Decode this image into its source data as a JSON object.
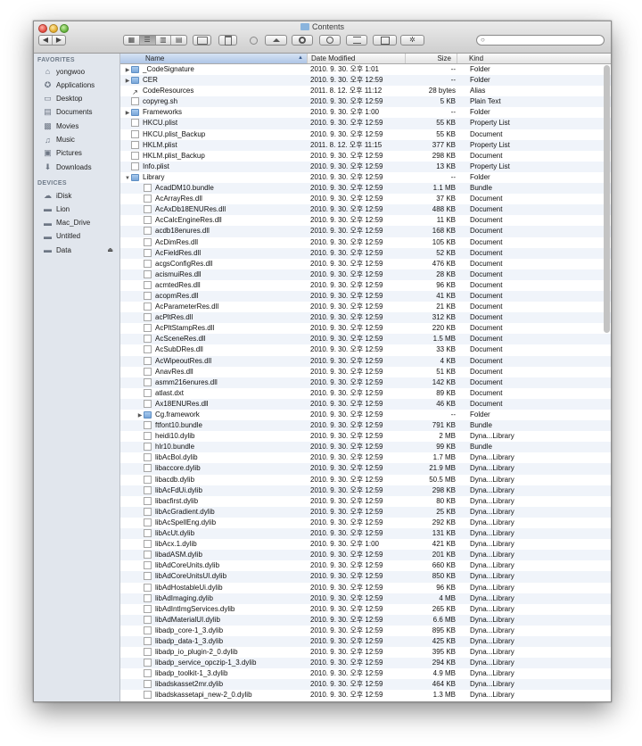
{
  "window": {
    "title": "Contents"
  },
  "toolbar": {
    "nav": [
      "◀",
      "▶"
    ],
    "view_modes": [
      "▦",
      "☰",
      "▥",
      "▤"
    ],
    "search_placeholder": ""
  },
  "sidebar": {
    "favorites_header": "FAVORITES",
    "favorites": [
      {
        "label": "yongwoo",
        "icon": "home-icon"
      },
      {
        "label": "Applications",
        "icon": "applications-icon"
      },
      {
        "label": "Desktop",
        "icon": "desktop-icon"
      },
      {
        "label": "Documents",
        "icon": "documents-icon"
      },
      {
        "label": "Movies",
        "icon": "movies-icon"
      },
      {
        "label": "Music",
        "icon": "music-icon"
      },
      {
        "label": "Pictures",
        "icon": "pictures-icon"
      },
      {
        "label": "Downloads",
        "icon": "downloads-icon"
      }
    ],
    "devices_header": "DEVICES",
    "devices": [
      {
        "label": "iDisk",
        "icon": "idisk-icon"
      },
      {
        "label": "Lion",
        "icon": "disk-icon"
      },
      {
        "label": "Mac_Drive",
        "icon": "disk-icon"
      },
      {
        "label": "Untitled",
        "icon": "disk-icon"
      },
      {
        "label": "Data",
        "icon": "disk-icon",
        "eject": "⏏"
      }
    ]
  },
  "columns": {
    "name": "Name",
    "date": "Date Modified",
    "size": "Size",
    "kind": "Kind"
  },
  "files": [
    {
      "name": "_CodeSignature",
      "date": "2010. 9. 30. 오후 1:01",
      "size": "--",
      "kind": "Folder",
      "depth": 0,
      "icon": "folder",
      "disc": "▶"
    },
    {
      "name": "CER",
      "date": "2010. 9. 30. 오후 12:59",
      "size": "--",
      "kind": "Folder",
      "depth": 0,
      "icon": "folder",
      "disc": "▶"
    },
    {
      "name": "CodeResources",
      "date": "2011. 8. 12. 오후 11:12",
      "size": "28 bytes",
      "kind": "Alias",
      "depth": 0,
      "icon": "alias"
    },
    {
      "name": "copyreg.sh",
      "date": "2010. 9. 30. 오후 12:59",
      "size": "5 KB",
      "kind": "Plain Text",
      "depth": 0,
      "icon": "doc"
    },
    {
      "name": "Frameworks",
      "date": "2010. 9. 30. 오후 1:00",
      "size": "--",
      "kind": "Folder",
      "depth": 0,
      "icon": "folder",
      "disc": "▶"
    },
    {
      "name": "HKCU.plist",
      "date": "2010. 9. 30. 오후 12:59",
      "size": "55 KB",
      "kind": "Property List",
      "depth": 0,
      "icon": "doc"
    },
    {
      "name": "HKCU.plist_Backup",
      "date": "2010. 9. 30. 오후 12:59",
      "size": "55 KB",
      "kind": "Document",
      "depth": 0,
      "icon": "doc"
    },
    {
      "name": "HKLM.plist",
      "date": "2011. 8. 12. 오후 11:15",
      "size": "377 KB",
      "kind": "Property List",
      "depth": 0,
      "icon": "doc"
    },
    {
      "name": "HKLM.plist_Backup",
      "date": "2010. 9. 30. 오후 12:59",
      "size": "298 KB",
      "kind": "Document",
      "depth": 0,
      "icon": "doc"
    },
    {
      "name": "Info.plist",
      "date": "2010. 9. 30. 오후 12:59",
      "size": "13 KB",
      "kind": "Property List",
      "depth": 0,
      "icon": "doc"
    },
    {
      "name": "Library",
      "date": "2010. 9. 30. 오후 12:59",
      "size": "--",
      "kind": "Folder",
      "depth": 0,
      "icon": "folder",
      "disc": "▼"
    },
    {
      "name": "AcadDM10.bundle",
      "date": "2010. 9. 30. 오후 12:59",
      "size": "1.1 MB",
      "kind": "Bundle",
      "depth": 1,
      "icon": "doc"
    },
    {
      "name": "AcArrayRes.dll",
      "date": "2010. 9. 30. 오후 12:59",
      "size": "37 KB",
      "kind": "Document",
      "depth": 1,
      "icon": "doc"
    },
    {
      "name": "AcAxDb18ENURes.dll",
      "date": "2010. 9. 30. 오후 12:59",
      "size": "488 KB",
      "kind": "Document",
      "depth": 1,
      "icon": "doc"
    },
    {
      "name": "AcCalcEngineRes.dll",
      "date": "2010. 9. 30. 오후 12:59",
      "size": "11 KB",
      "kind": "Document",
      "depth": 1,
      "icon": "doc"
    },
    {
      "name": "acdb18enures.dll",
      "date": "2010. 9. 30. 오후 12:59",
      "size": "168 KB",
      "kind": "Document",
      "depth": 1,
      "icon": "doc"
    },
    {
      "name": "AcDimRes.dll",
      "date": "2010. 9. 30. 오후 12:59",
      "size": "105 KB",
      "kind": "Document",
      "depth": 1,
      "icon": "doc"
    },
    {
      "name": "AcFieldRes.dll",
      "date": "2010. 9. 30. 오후 12:59",
      "size": "52 KB",
      "kind": "Document",
      "depth": 1,
      "icon": "doc"
    },
    {
      "name": "acgsConfigRes.dll",
      "date": "2010. 9. 30. 오후 12:59",
      "size": "476 KB",
      "kind": "Document",
      "depth": 1,
      "icon": "doc"
    },
    {
      "name": "acismuiRes.dll",
      "date": "2010. 9. 30. 오후 12:59",
      "size": "28 KB",
      "kind": "Document",
      "depth": 1,
      "icon": "doc"
    },
    {
      "name": "acmtedRes.dll",
      "date": "2010. 9. 30. 오후 12:59",
      "size": "96 KB",
      "kind": "Document",
      "depth": 1,
      "icon": "doc"
    },
    {
      "name": "acopmRes.dll",
      "date": "2010. 9. 30. 오후 12:59",
      "size": "41 KB",
      "kind": "Document",
      "depth": 1,
      "icon": "doc"
    },
    {
      "name": "AcParameterRes.dll",
      "date": "2010. 9. 30. 오후 12:59",
      "size": "21 KB",
      "kind": "Document",
      "depth": 1,
      "icon": "doc"
    },
    {
      "name": "acPltRes.dll",
      "date": "2010. 9. 30. 오후 12:59",
      "size": "312 KB",
      "kind": "Document",
      "depth": 1,
      "icon": "doc"
    },
    {
      "name": "AcPltStampRes.dll",
      "date": "2010. 9. 30. 오후 12:59",
      "size": "220 KB",
      "kind": "Document",
      "depth": 1,
      "icon": "doc"
    },
    {
      "name": "AcSceneRes.dll",
      "date": "2010. 9. 30. 오후 12:59",
      "size": "1.5 MB",
      "kind": "Document",
      "depth": 1,
      "icon": "doc"
    },
    {
      "name": "AcSubDRes.dll",
      "date": "2010. 9. 30. 오후 12:59",
      "size": "33 KB",
      "kind": "Document",
      "depth": 1,
      "icon": "doc"
    },
    {
      "name": "AcWipeoutRes.dll",
      "date": "2010. 9. 30. 오후 12:59",
      "size": "4 KB",
      "kind": "Document",
      "depth": 1,
      "icon": "doc"
    },
    {
      "name": "AnavRes.dll",
      "date": "2010. 9. 30. 오후 12:59",
      "size": "51 KB",
      "kind": "Document",
      "depth": 1,
      "icon": "doc"
    },
    {
      "name": "asmm216enures.dll",
      "date": "2010. 9. 30. 오후 12:59",
      "size": "142 KB",
      "kind": "Document",
      "depth": 1,
      "icon": "doc"
    },
    {
      "name": "atlast.dxt",
      "date": "2010. 9. 30. 오후 12:59",
      "size": "89 KB",
      "kind": "Document",
      "depth": 1,
      "icon": "doc"
    },
    {
      "name": "Ax18ENURes.dll",
      "date": "2010. 9. 30. 오후 12:59",
      "size": "46 KB",
      "kind": "Document",
      "depth": 1,
      "icon": "doc"
    },
    {
      "name": "Cg.framework",
      "date": "2010. 9. 30. 오후 12:59",
      "size": "--",
      "kind": "Folder",
      "depth": 1,
      "icon": "folder",
      "disc": "▶"
    },
    {
      "name": "ftfont10.bundle",
      "date": "2010. 9. 30. 오후 12:59",
      "size": "791 KB",
      "kind": "Bundle",
      "depth": 1,
      "icon": "doc"
    },
    {
      "name": "heidi10.dylib",
      "date": "2010. 9. 30. 오후 12:59",
      "size": "2 MB",
      "kind": "Dyna...Library",
      "depth": 1,
      "icon": "doc"
    },
    {
      "name": "hlr10.bundle",
      "date": "2010. 9. 30. 오후 12:59",
      "size": "99 KB",
      "kind": "Bundle",
      "depth": 1,
      "icon": "doc"
    },
    {
      "name": "libAcBol.dylib",
      "date": "2010. 9. 30. 오후 12:59",
      "size": "1.7 MB",
      "kind": "Dyna...Library",
      "depth": 1,
      "icon": "doc"
    },
    {
      "name": "libaccore.dylib",
      "date": "2010. 9. 30. 오후 12:59",
      "size": "21.9 MB",
      "kind": "Dyna...Library",
      "depth": 1,
      "icon": "doc"
    },
    {
      "name": "libacdb.dylib",
      "date": "2010. 9. 30. 오후 12:59",
      "size": "50.5 MB",
      "kind": "Dyna...Library",
      "depth": 1,
      "icon": "doc"
    },
    {
      "name": "libAcFdUi.dylib",
      "date": "2010. 9. 30. 오후 12:59",
      "size": "298 KB",
      "kind": "Dyna...Library",
      "depth": 1,
      "icon": "doc"
    },
    {
      "name": "libacfirst.dylib",
      "date": "2010. 9. 30. 오후 12:59",
      "size": "80 KB",
      "kind": "Dyna...Library",
      "depth": 1,
      "icon": "doc"
    },
    {
      "name": "libAcGradient.dylib",
      "date": "2010. 9. 30. 오후 12:59",
      "size": "25 KB",
      "kind": "Dyna...Library",
      "depth": 1,
      "icon": "doc"
    },
    {
      "name": "libAcSpellEng.dylib",
      "date": "2010. 9. 30. 오후 12:59",
      "size": "292 KB",
      "kind": "Dyna...Library",
      "depth": 1,
      "icon": "doc"
    },
    {
      "name": "libAcUt.dylib",
      "date": "2010. 9. 30. 오후 12:59",
      "size": "131 KB",
      "kind": "Dyna...Library",
      "depth": 1,
      "icon": "doc"
    },
    {
      "name": "libAcx.1.dylib",
      "date": "2010. 9. 30. 오후 1:00",
      "size": "421 KB",
      "kind": "Dyna...Library",
      "depth": 1,
      "icon": "doc"
    },
    {
      "name": "libadASM.dylib",
      "date": "2010. 9. 30. 오후 12:59",
      "size": "201 KB",
      "kind": "Dyna...Library",
      "depth": 1,
      "icon": "doc"
    },
    {
      "name": "libAdCoreUnits.dylib",
      "date": "2010. 9. 30. 오후 12:59",
      "size": "660 KB",
      "kind": "Dyna...Library",
      "depth": 1,
      "icon": "doc"
    },
    {
      "name": "libAdCoreUnitsUI.dylib",
      "date": "2010. 9. 30. 오후 12:59",
      "size": "850 KB",
      "kind": "Dyna...Library",
      "depth": 1,
      "icon": "doc"
    },
    {
      "name": "libAdHostableUi.dylib",
      "date": "2010. 9. 30. 오후 12:59",
      "size": "96 KB",
      "kind": "Dyna...Library",
      "depth": 1,
      "icon": "doc"
    },
    {
      "name": "libAdImaging.dylib",
      "date": "2010. 9. 30. 오후 12:59",
      "size": "4 MB",
      "kind": "Dyna...Library",
      "depth": 1,
      "icon": "doc"
    },
    {
      "name": "libAdIntImgServices.dylib",
      "date": "2010. 9. 30. 오후 12:59",
      "size": "265 KB",
      "kind": "Dyna...Library",
      "depth": 1,
      "icon": "doc"
    },
    {
      "name": "libAdMaterialUI.dylib",
      "date": "2010. 9. 30. 오후 12:59",
      "size": "6.6 MB",
      "kind": "Dyna...Library",
      "depth": 1,
      "icon": "doc"
    },
    {
      "name": "libadp_core-1_3.dylib",
      "date": "2010. 9. 30. 오후 12:59",
      "size": "895 KB",
      "kind": "Dyna...Library",
      "depth": 1,
      "icon": "doc"
    },
    {
      "name": "libadp_data-1_3.dylib",
      "date": "2010. 9. 30. 오후 12:59",
      "size": "425 KB",
      "kind": "Dyna...Library",
      "depth": 1,
      "icon": "doc"
    },
    {
      "name": "libadp_io_plugin-2_0.dylib",
      "date": "2010. 9. 30. 오후 12:59",
      "size": "395 KB",
      "kind": "Dyna...Library",
      "depth": 1,
      "icon": "doc"
    },
    {
      "name": "libadp_service_opczip-1_3.dylib",
      "date": "2010. 9. 30. 오후 12:59",
      "size": "294 KB",
      "kind": "Dyna...Library",
      "depth": 1,
      "icon": "doc"
    },
    {
      "name": "libadp_toolkit-1_3.dylib",
      "date": "2010. 9. 30. 오후 12:59",
      "size": "4.9 MB",
      "kind": "Dyna...Library",
      "depth": 1,
      "icon": "doc"
    },
    {
      "name": "libadskasset2mr.dylib",
      "date": "2010. 9. 30. 오후 12:59",
      "size": "464 KB",
      "kind": "Dyna...Library",
      "depth": 1,
      "icon": "doc"
    },
    {
      "name": "libadskassetapi_new-2_0.dylib",
      "date": "2010. 9. 30. 오후 12:59",
      "size": "1.3 MB",
      "kind": "Dyna...Library",
      "depth": 1,
      "icon": "doc"
    }
  ]
}
